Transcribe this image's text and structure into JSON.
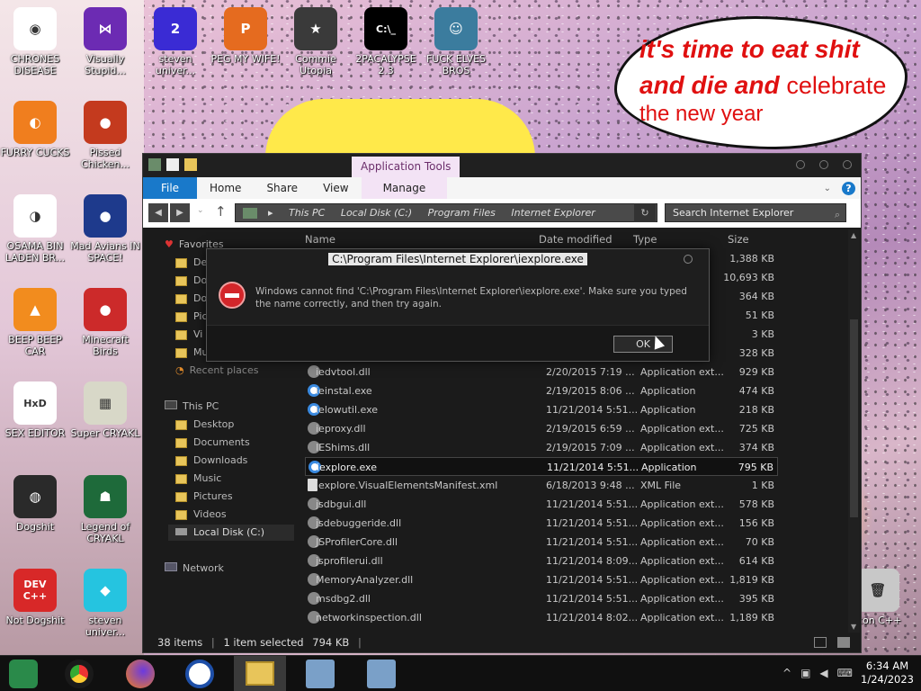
{
  "desktop": {
    "icons": [
      {
        "label": "CHRONES DISEASE",
        "color": "#ffffff",
        "glyph": "◉"
      },
      {
        "label": "Visually Stupid...",
        "color": "#6c2bb3",
        "glyph": "⋈"
      },
      {
        "label": "steven univer...",
        "color": "#3a2bd4",
        "glyph": "2"
      },
      {
        "label": "PEG MY WIFE!",
        "color": "#e56b1f",
        "glyph": "P"
      },
      {
        "label": "Commie Utopia",
        "color": "#3a3a3a",
        "glyph": "★"
      },
      {
        "label": "2PACALYPSE 2.3",
        "color": "#000000",
        "glyph": "C:\\_"
      },
      {
        "label": "FUCK ELVES BROS",
        "color": "#3b7c9e",
        "glyph": "☺"
      },
      {
        "label": "FURRY CUCKS",
        "color": "#f07e1e",
        "glyph": "◐"
      },
      {
        "label": "Pissed Chicken...",
        "color": "#c43a1e",
        "glyph": "●"
      },
      {
        "label": "OSAMA BIN LADEN BR...",
        "color": "#ffffff",
        "glyph": "◑"
      },
      {
        "label": "Mad Avians IN SPACE!",
        "color": "#1e3a8c",
        "glyph": "●"
      },
      {
        "label": "BEEP BEEP CAR",
        "color": "#f28c1e",
        "glyph": "▲"
      },
      {
        "label": "Minecraft Birds",
        "color": "#cc2a2a",
        "glyph": "●"
      },
      {
        "label": "SEX EDITOR",
        "color": "#ffffff",
        "glyph": "HxD"
      },
      {
        "label": "Super CRYAKL",
        "color": "#d8d8c8",
        "glyph": "▦"
      },
      {
        "label": "Dogshit",
        "color": "#2a2a2a",
        "glyph": "◍"
      },
      {
        "label": "Legend of CRYAKL",
        "color": "#1e6a3a",
        "glyph": "☗"
      },
      {
        "label": "Not Dogshit",
        "color": "#d82828",
        "glyph": "DEV C++"
      },
      {
        "label": "steven univer...",
        "color": "#25c4e0",
        "glyph": "◆"
      },
      {
        "label": "Icon C++",
        "color": "#c8c8c8",
        "glyph": "🗑"
      }
    ],
    "bubble": {
      "line1": "it's time to eat shit",
      "line2": "and die and",
      "line2b": "celebrate",
      "line3": "the new year"
    }
  },
  "explorer": {
    "app_tools": "Application Tools",
    "tabs": [
      "File",
      "Home",
      "Share",
      "View",
      "Manage"
    ],
    "breadcrumbs": [
      "This PC",
      "Local Disk (C:)",
      "Program Files",
      "Internet Explorer"
    ],
    "search_placeholder": "Search Internet Explorer",
    "nav": {
      "favorites": "Favorites",
      "fav_items": [
        "De",
        "Do",
        "Do",
        "Pic",
        "Vi",
        "Mu"
      ],
      "recent": "Recent places",
      "this_pc": "This PC",
      "pc_items": [
        "Desktop",
        "Documents",
        "Downloads",
        "Music",
        "Pictures",
        "Videos",
        "Local Disk (C:)"
      ],
      "network": "Network"
    },
    "columns": {
      "name": "Name",
      "date": "Date modified",
      "type": "Type",
      "size": "Size"
    },
    "rows": [
      {
        "name": "",
        "date": "",
        "type": "",
        "size": "1,388 KB"
      },
      {
        "name": "",
        "date": "",
        "type": "",
        "size": "10,693 KB"
      },
      {
        "name": "",
        "date": "",
        "type": "",
        "size": "364 KB"
      },
      {
        "name": "",
        "date": "",
        "type": "",
        "size": "51 KB"
      },
      {
        "name": "",
        "date": "",
        "type": "",
        "size": "3 KB"
      },
      {
        "name": "",
        "date": "",
        "type": "",
        "size": "328 KB"
      },
      {
        "name": "iedvtool.dll",
        "date": "2/20/2015 7:19 ...",
        "type": "Application ext...",
        "size": "929 KB",
        "icon": "gear"
      },
      {
        "name": "ieinstal.exe",
        "date": "2/19/2015 8:06 ...",
        "type": "Application",
        "size": "474 KB",
        "icon": "ie"
      },
      {
        "name": "ielowutil.exe",
        "date": "11/21/2014 5:51...",
        "type": "Application",
        "size": "218 KB",
        "icon": "ie"
      },
      {
        "name": "ieproxy.dll",
        "date": "2/19/2015 6:59 ...",
        "type": "Application ext...",
        "size": "725 KB",
        "icon": "gear"
      },
      {
        "name": "IEShims.dll",
        "date": "2/19/2015 7:09 ...",
        "type": "Application ext...",
        "size": "374 KB",
        "icon": "gear"
      },
      {
        "name": "iexplore.exe",
        "date": "11/21/2014 5:51...",
        "type": "Application",
        "size": "795 KB",
        "icon": "ie",
        "selected": true
      },
      {
        "name": "iexplore.VisualElementsManifest.xml",
        "date": "6/18/2013 9:48 ...",
        "type": "XML File",
        "size": "1 KB",
        "icon": "doc"
      },
      {
        "name": "jsdbgui.dll",
        "date": "11/21/2014 5:51...",
        "type": "Application ext...",
        "size": "578 KB",
        "icon": "gear"
      },
      {
        "name": "jsdebuggeride.dll",
        "date": "11/21/2014 5:51...",
        "type": "Application ext...",
        "size": "156 KB",
        "icon": "gear"
      },
      {
        "name": "JSProfilerCore.dll",
        "date": "11/21/2014 5:51...",
        "type": "Application ext...",
        "size": "70 KB",
        "icon": "gear"
      },
      {
        "name": "jsprofilerui.dll",
        "date": "11/21/2014 8:09...",
        "type": "Application ext...",
        "size": "614 KB",
        "icon": "gear"
      },
      {
        "name": "MemoryAnalyzer.dll",
        "date": "11/21/2014 5:51...",
        "type": "Application ext...",
        "size": "1,819 KB",
        "icon": "gear"
      },
      {
        "name": "msdbg2.dll",
        "date": "11/21/2014 5:51...",
        "type": "Application ext...",
        "size": "395 KB",
        "icon": "gear"
      },
      {
        "name": "networkinspection.dll",
        "date": "11/21/2014 8:02...",
        "type": "Application ext...",
        "size": "1,189 KB",
        "icon": "gear"
      }
    ],
    "status": {
      "count": "38 items",
      "selected": "1 item selected",
      "size": "794 KB"
    }
  },
  "dialog": {
    "title": "C:\\Program Files\\Internet Explorer\\iexplore.exe",
    "message": "Windows cannot find 'C:\\Program Files\\Internet Explorer\\iexplore.exe'. Make sure you typed the name correctly, and then try again.",
    "ok": "OK"
  },
  "taskbar": {
    "time": "6:34 AM",
    "date": "1/24/2023"
  }
}
